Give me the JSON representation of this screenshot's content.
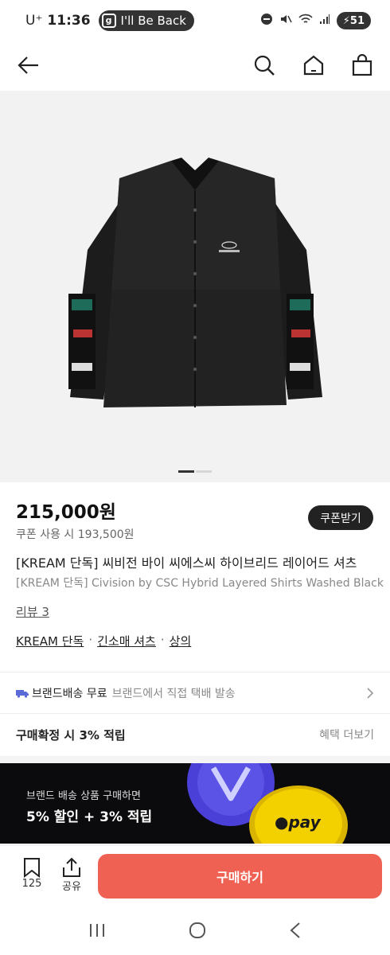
{
  "status": {
    "carrier": "U⁺",
    "time": "11:36",
    "app_pill": "I'll Be Back",
    "battery": "51"
  },
  "nav": {
    "icons": [
      "back-arrow-icon",
      "search-icon",
      "home-icon",
      "shopping-bag-icon"
    ]
  },
  "product": {
    "image_icon": "black-layered-shirt-image",
    "price": "215,000원",
    "coupon_price": "쿠폰 사용 시 193,500원",
    "coupon_button": "쿠폰받기",
    "title_ko": "[KREAM 단독] 씨비전 바이 씨에스씨 하이브리드 레이어드 셔츠",
    "title_en": "[KREAM 단독] Civision by CSC Hybrid Layered Shirts Washed Black",
    "review": "리뷰 3",
    "categories": [
      "KREAM 단독",
      "긴소매 셔츠",
      "상의"
    ],
    "category_separator": "·"
  },
  "shipping": {
    "label": "브랜드배송 무료",
    "sub": "브랜드에서 직접 택배 발송"
  },
  "points": {
    "label": "구매확정 시 3% 적립",
    "more": "혜택 더보기"
  },
  "banner": {
    "sub": "브랜드 배송 상품 구매하면",
    "main": "5% 할인 + 3% 적립",
    "pay_logo": "pay"
  },
  "bottom": {
    "wish_count": "125",
    "share_label": "공유",
    "buy_label": "구매하기"
  },
  "colors": {
    "buy_button": "#ef6253",
    "banner_bg": "#0b0b0d",
    "coupon_btn": "#222222"
  }
}
